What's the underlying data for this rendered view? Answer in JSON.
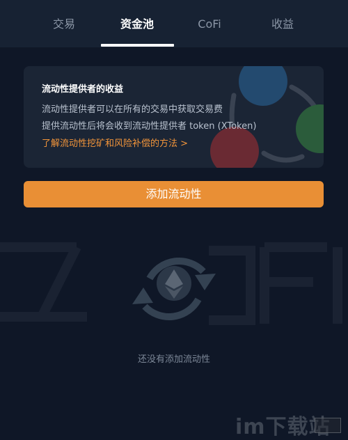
{
  "tabs": [
    {
      "label": "交易",
      "active": false
    },
    {
      "label": "资金池",
      "active": true
    },
    {
      "label": "CoFi",
      "active": false
    },
    {
      "label": "收益",
      "active": false
    }
  ],
  "info_card": {
    "title": "流动性提供者的收益",
    "line1": "流动性提供者可以在所有的交易中获取交易费",
    "line2": "提供流动性后将会收到流动性提供者 token (XToken)",
    "link": "了解流动性挖矿和风险补偿的方法 >"
  },
  "add_liquidity_button": "添加流动性",
  "empty_state": {
    "text": "还没有添加流动性",
    "icon": "ethereum-swap-icon"
  },
  "watermark": {
    "text": "im下载站",
    "icon": "watermark-logo-icon"
  },
  "colors": {
    "background": "#0f1727",
    "tabbar": "#172233",
    "card": "#1b2535",
    "accent": "#e98f35",
    "link": "#f3953a"
  }
}
